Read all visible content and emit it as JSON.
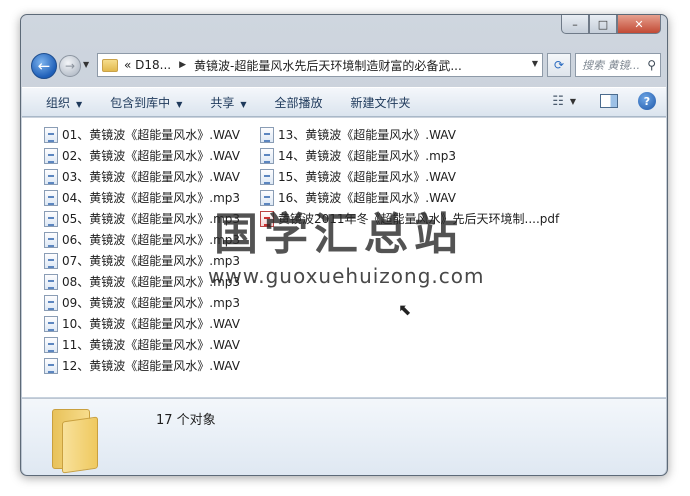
{
  "window": {
    "min_label": "–",
    "max_label": "□",
    "close_label": "✕"
  },
  "nav": {
    "back_glyph": "←",
    "forward_glyph": "→",
    "address_prefix": "«  D18...",
    "address_current": "黄镜波-超能量风水先后天环境制造财富的必备武...",
    "search_placeholder": "搜索 黄镜..."
  },
  "toolbar": {
    "organize": "组织",
    "include_in_library": "包含到库中",
    "share": "共享",
    "play_all": "全部播放",
    "new_folder": "新建文件夹"
  },
  "files": [
    "01、黄镜波《超能量风水》.WAV",
    "02、黄镜波《超能量风水》.WAV",
    "03、黄镜波《超能量风水》.WAV",
    "04、黄镜波《超能量风水》.mp3",
    "05、黄镜波《超能量风水》.mp3",
    "06、黄镜波《超能量风水》.mp3",
    "07、黄镜波《超能量风水》.mp3",
    "08、黄镜波《超能量风水》.mp3",
    "09、黄镜波《超能量风水》.mp3",
    "10、黄镜波《超能量风水》.WAV",
    "11、黄镜波《超能量风水》.WAV",
    "12、黄镜波《超能量风水》.WAV",
    "13、黄镜波《超能量风水》.WAV",
    "14、黄镜波《超能量风水》.mp3",
    "15、黄镜波《超能量风水》.WAV",
    "16、黄镜波《超能量风水》.WAV",
    "黄镜波2011年冬《超能量风水》先后天环境制....pdf"
  ],
  "watermark": {
    "site_cn": "国学汇总站",
    "site_url": "www.guoxuehuizong.com"
  },
  "details": {
    "count_text": "17 个对象"
  }
}
